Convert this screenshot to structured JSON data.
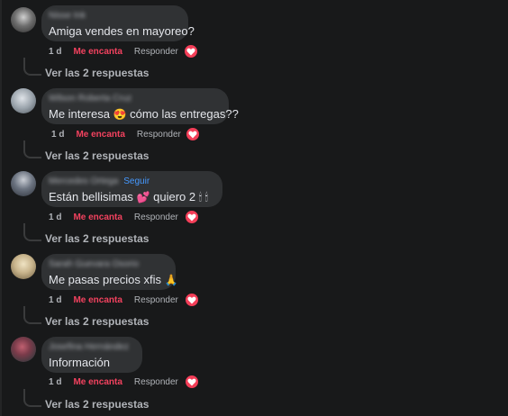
{
  "comments": [
    {
      "author": "Nisse Ink",
      "text": "Amiga vendes en mayoreo?",
      "time": "1 d",
      "love_label": "Me encanta",
      "reply_label": "Responder",
      "replies_label": "Ver las 2 respuestas",
      "avatar_color": "#8a8a8a"
    },
    {
      "author": "Wilson Roberta Cruz",
      "text_before": "Me interesa",
      "emoji": "😍",
      "text_after": "cómo las entregas??",
      "time": "1 d",
      "love_label": "Me encanta",
      "reply_label": "Responder",
      "replies_label": "Ver las 2 respuestas",
      "avatar_color": "#9aa3ab"
    },
    {
      "author": "Mercedes Ortega",
      "follow_label": "Seguir",
      "text_before": "Están bellisimas",
      "emoji": "💕",
      "text_after": "quiero 2",
      "emoji_tail": "🕯 🕯",
      "time": "1 d",
      "love_label": "Me encanta",
      "reply_label": "Responder",
      "replies_label": "Ver las 2 respuestas",
      "avatar_color": "#6b7380"
    },
    {
      "author": "Sarah Guevara Osorio",
      "text_before": "Me pasas precios xfis",
      "emoji": "🙏",
      "time": "1 d",
      "love_label": "Me encanta",
      "reply_label": "Responder",
      "replies_label": "Ver las 2 respuestas",
      "avatar_color": "#c8b48c"
    },
    {
      "author": "Josefina Hernández",
      "text": "Información",
      "time": "1 d",
      "love_label": "Me encanta",
      "reply_label": "Responder",
      "replies_label": "Ver las 2 respuestas",
      "avatar_color": "#7a3b4a"
    }
  ],
  "colors": {
    "background": "#18191a",
    "bubble": "#303234",
    "love": "#f3425f",
    "follow": "#4599ff"
  },
  "icons": {
    "reaction": "heart-icon"
  }
}
